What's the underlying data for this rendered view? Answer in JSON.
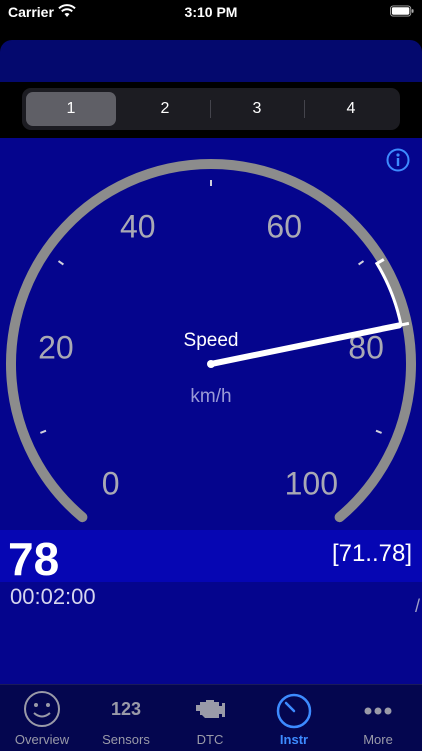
{
  "status_bar": {
    "carrier": "Carrier",
    "time": "3:10 PM"
  },
  "segments": [
    "1",
    "2",
    "3",
    "4"
  ],
  "selected_segment": "1",
  "gauge": {
    "title": "Speed",
    "unit": "km/h",
    "ticks": [
      "0",
      "20",
      "40",
      "60",
      "80",
      "100"
    ],
    "value": 78,
    "min": 0,
    "max": 100,
    "range_highlight": [
      71,
      78
    ]
  },
  "readout": {
    "value": "78",
    "range": "[71..78]",
    "elapsed": "00:02:00"
  },
  "tabs": [
    {
      "label": "Overview",
      "icon": "smiley-icon"
    },
    {
      "label": "Sensors",
      "icon": "123-icon",
      "glyph": "123"
    },
    {
      "label": "DTC",
      "icon": "engine-icon"
    },
    {
      "label": "Instr",
      "icon": "gauge-icon"
    },
    {
      "label": "More",
      "icon": "more-dots-icon"
    }
  ],
  "active_tab": "Instr",
  "colors": {
    "panel": "#05058d",
    "readout": "#0606b3",
    "accent": "#3d8bff"
  }
}
